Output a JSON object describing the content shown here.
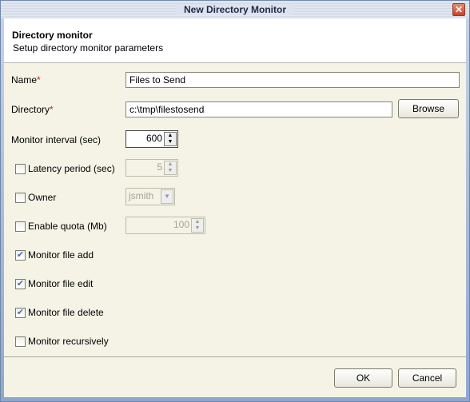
{
  "window": {
    "title": "New Directory Monitor",
    "close_icon": "close-icon"
  },
  "header": {
    "title": "Directory monitor",
    "subtitle": "Setup directory monitor parameters"
  },
  "form": {
    "name": {
      "label": "Name",
      "required": "*",
      "value": "Files to Send"
    },
    "directory": {
      "label": "Directory",
      "required": "*",
      "value": "c:\\tmp\\filestosend",
      "browse": "Browse"
    },
    "interval": {
      "label": "Monitor interval (sec)",
      "value": "600"
    },
    "latency": {
      "label": "Latency period (sec)",
      "checked": false,
      "value": "5"
    },
    "owner": {
      "label": "Owner",
      "checked": false,
      "value": "jsmith"
    },
    "quota": {
      "label": "Enable quota (Mb)",
      "checked": false,
      "value": "100"
    },
    "file_add": {
      "label": "Monitor file add",
      "checked": true
    },
    "file_edit": {
      "label": "Monitor file edit",
      "checked": true
    },
    "file_delete": {
      "label": "Monitor file delete",
      "checked": true
    },
    "recursive": {
      "label": "Monitor recursively",
      "checked": false
    }
  },
  "buttons": {
    "ok": "OK",
    "cancel": "Cancel"
  },
  "colors": {
    "required": "#c0281e",
    "panel": "#f4f3e6",
    "check": "#4a6eb0"
  }
}
